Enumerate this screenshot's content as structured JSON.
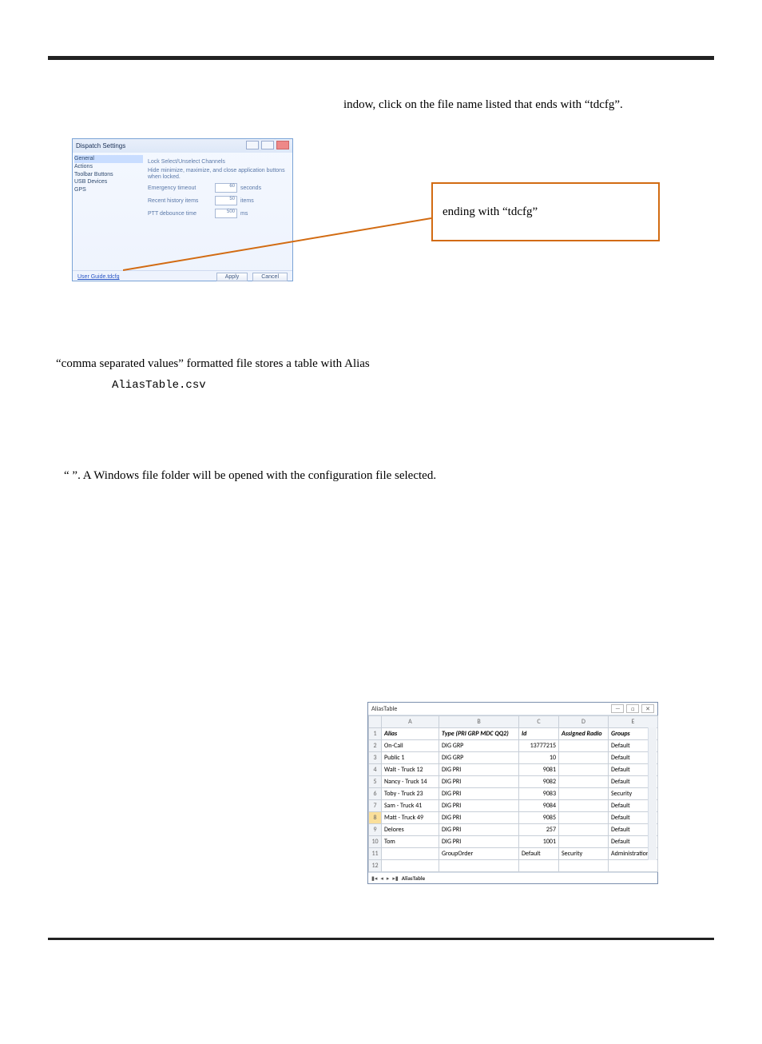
{
  "topRightText": "indow, click on the file name listed that ends with “tdcfg”.",
  "dispatch": {
    "title": "Dispatch Settings",
    "tree": {
      "items": [
        "General",
        "Actions",
        "Toolbar Buttons",
        "USB Devices",
        "GPS"
      ],
      "selectedIndex": 0
    },
    "checks": {
      "lockSelect": "Lock Select/Unselect Channels",
      "hideMin": "Hide minimize, maximize, and close application buttons when locked."
    },
    "rows": {
      "r1": {
        "label": "Emergency timeout",
        "value": "60",
        "unit": "seconds"
      },
      "r2": {
        "label": "Recent history items",
        "value": "50",
        "unit": "items"
      },
      "r3": {
        "label": "PTT debounce time",
        "value": "500",
        "unit": "ms"
      }
    },
    "link": "User Guide.tdcfg",
    "apply": "Apply",
    "cancel": "Cancel"
  },
  "callout": "ending with “tdcfg”",
  "csvPara": "“comma separated values” formatted file stores a table with Alias",
  "csvFile": "AliasTable.csv",
  "folderPara": "“    ”.  A Windows file folder will be opened with the configuration file selected.",
  "aliasWindow": {
    "title": "AliasTable",
    "columns": [
      "",
      "A",
      "B",
      "C",
      "D",
      "E"
    ],
    "headerRow": [
      "1",
      "Alias",
      "Type (PRI GRP MDC QQ2)",
      "Id",
      "Assigned Radio",
      "Groups"
    ],
    "sheetTab": "AliasTable"
  },
  "chart_data": {
    "type": "table",
    "title": "AliasTable",
    "columns": [
      "Alias",
      "Type (PRI GRP MDC QQ2)",
      "Id",
      "Assigned Radio",
      "Groups"
    ],
    "rows": [
      {
        "n": "2",
        "Alias": "On-Call",
        "Type": "DIG GRP",
        "Id": "13777215",
        "Assigned": "",
        "Groups": "Default"
      },
      {
        "n": "3",
        "Alias": "Public 1",
        "Type": "DIG GRP",
        "Id": "10",
        "Assigned": "",
        "Groups": "Default"
      },
      {
        "n": "4",
        "Alias": "Walt - Truck 12",
        "Type": "DIG PRI",
        "Id": "9081",
        "Assigned": "",
        "Groups": "Default"
      },
      {
        "n": "5",
        "Alias": "Nancy - Truck 14",
        "Type": "DIG PRI",
        "Id": "9082",
        "Assigned": "",
        "Groups": "Default"
      },
      {
        "n": "6",
        "Alias": "Toby - Truck 23",
        "Type": "DIG PRI",
        "Id": "9083",
        "Assigned": "",
        "Groups": "Security"
      },
      {
        "n": "7",
        "Alias": "Sam - Truck 41",
        "Type": "DIG PRI",
        "Id": "9084",
        "Assigned": "",
        "Groups": "Default"
      },
      {
        "n": "8",
        "Alias": "Matt - Truck 49",
        "Type": "DIG PRI",
        "Id": "9085",
        "Assigned": "",
        "Groups": "Default"
      },
      {
        "n": "9",
        "Alias": "Delores",
        "Type": "DIG PRI",
        "Id": "257",
        "Assigned": "",
        "Groups": "Default"
      },
      {
        "n": "10",
        "Alias": "Tom",
        "Type": "DIG PRI",
        "Id": "1001",
        "Assigned": "",
        "Groups": "Default"
      },
      {
        "n": "11",
        "Alias": "",
        "Type": "GroupOrder",
        "Id": "Default",
        "Assigned": "Security",
        "Groups": "Administration"
      },
      {
        "n": "12",
        "Alias": "",
        "Type": "",
        "Id": "",
        "Assigned": "",
        "Groups": ""
      }
    ]
  }
}
